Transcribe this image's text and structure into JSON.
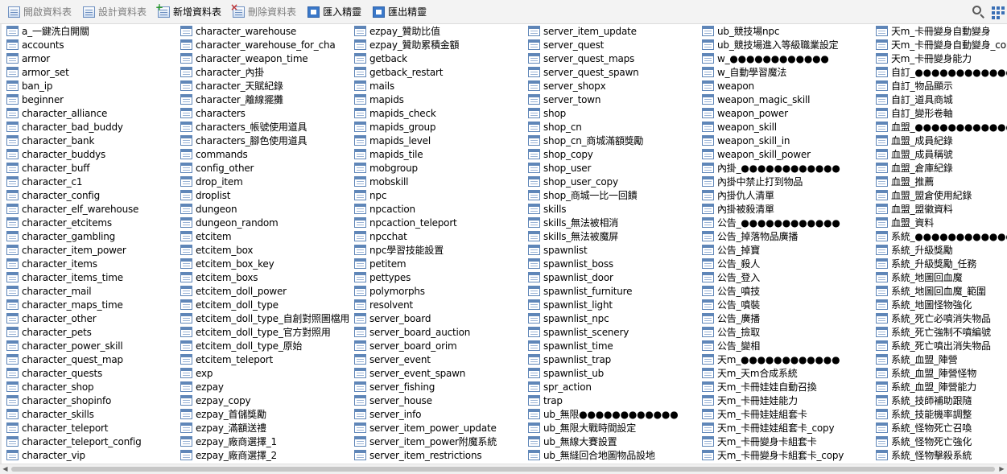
{
  "toolbar": {
    "open_table": "開啟資料表",
    "design_table": "設計資料表",
    "new_table": "新增資料表",
    "delete_table": "刪除資料表",
    "import_wizard": "匯入精靈",
    "export_wizard": "匯出精靈"
  },
  "icons": {
    "search": "search-icon",
    "view_mode": "grid-view-icon",
    "table": "table-icon"
  },
  "colors": {
    "toolbar_bg": "#f3f3f3",
    "table_icon": "#5f86b8",
    "disabled_text": "#7d7d7d"
  },
  "tables": [
    [
      "a_一鍵洗白開關",
      "accounts",
      "armor",
      "armor_set",
      "ban_ip",
      "beginner",
      "character_alliance",
      "character_bad_buddy",
      "character_bank",
      "character_buddys",
      "character_buff",
      "character_c1",
      "character_config",
      "character_elf_warehouse",
      "character_etcitems",
      "character_gambling",
      "character_item_power",
      "character_items",
      "character_items_time",
      "character_mail",
      "character_maps_time",
      "character_other",
      "character_pets",
      "character_power_skill",
      "character_quest_map",
      "character_quests",
      "character_shop",
      "character_shopinfo",
      "character_skills",
      "character_teleport",
      "character_teleport_config",
      "character_vip"
    ],
    [
      "character_warehouse",
      "character_warehouse_for_cha",
      "character_weapon_time",
      "character_內掛",
      "character_天賦紀錄",
      "character_離線擺攤",
      "characters",
      "characters_帳號使用道具",
      "characters_腳色使用道具",
      "commands",
      "config_other",
      "drop_item",
      "droplist",
      "dungeon",
      "dungeon_random",
      "etcitem",
      "etcitem_box",
      "etcitem_box_key",
      "etcitem_boxs",
      "etcitem_doll_power",
      "etcitem_doll_type",
      "etcitem_doll_type_自創對照圖檔用",
      "etcitem_doll_type_官方對照用",
      "etcitem_doll_type_原始",
      "etcitem_teleport",
      "exp",
      "ezpay",
      "ezpay_copy",
      "ezpay_首儲獎勵",
      "ezpay_滿額送禮",
      "ezpay_廠商選擇_1",
      "ezpay_廠商選擇_2"
    ],
    [
      "ezpay_贊助比值",
      "ezpay_贊助累積金額",
      "getback",
      "getback_restart",
      "mails",
      "mapids",
      "mapids_check",
      "mapids_group",
      "mapids_level",
      "mapids_tile",
      "mobgroup",
      "mobskill",
      "npc",
      "npcaction",
      "npcaction_teleport",
      "npcchat",
      "npc學習技能設置",
      "petitem",
      "pettypes",
      "polymorphs",
      "resolvent",
      "server_board",
      "server_board_auction",
      "server_board_orim",
      "server_event",
      "server_event_spawn",
      "server_fishing",
      "server_house",
      "server_info",
      "server_item_power_update",
      "server_item_power附魔系統",
      "server_item_restrictions"
    ],
    [
      "server_item_update",
      "server_quest",
      "server_quest_maps",
      "server_quest_spawn",
      "server_shopx",
      "server_town",
      "shop",
      "shop_cn",
      "shop_cn_商城滿額獎勵",
      "shop_copy",
      "shop_user",
      "shop_user_copy",
      "shop_商城一比一回饋",
      "skills",
      "skills_無法被相消",
      "skills_無法被魔屏",
      "spawnlist",
      "spawnlist_boss",
      "spawnlist_door",
      "spawnlist_furniture",
      "spawnlist_light",
      "spawnlist_npc",
      "spawnlist_scenery",
      "spawnlist_time",
      "spawnlist_trap",
      "spawnlist_ub",
      "spr_action",
      "trap",
      "ub_無限●●●●●●●●●●●●",
      "ub_無限大戰時間設定",
      "ub_無線大賽設置",
      "ub_無縫回合地圖物品設地"
    ],
    [
      "ub_競技場npc",
      "ub_競技場進入等級職業設定",
      "w_●●●●●●●●●●●●",
      "w_自動學習魔法",
      "weapon",
      "weapon_magic_skill",
      "weapon_power",
      "weapon_skill",
      "weapon_skill_in",
      "weapon_skill_power",
      "內掛_●●●●●●●●●●●●",
      "內掛中禁止打到物品",
      "內掛仇人清單",
      "內掛被殺清單",
      "公告_●●●●●●●●●●●●",
      "公告_掉落物品廣播",
      "公告_掉寶",
      "公告_殺人",
      "公告_登入",
      "公告_噴技",
      "公告_噴裝",
      "公告_廣播",
      "公告_撿取",
      "公告_變相",
      "天m_●●●●●●●●●●●●",
      "天m_天m合成系統",
      "天m_卡冊娃娃自動召換",
      "天m_卡冊娃娃能力",
      "天m_卡冊娃娃組套卡",
      "天m_卡冊娃娃組套卡_copy",
      "天m_卡冊變身卡組套卡",
      "天m_卡冊變身卡組套卡_copy"
    ],
    [
      "天m_卡冊變身自動變身",
      "天m_卡冊變身自動變身_copy",
      "天m_卡冊變身能力",
      "自訂_●●●●●●●●●●●●",
      "自訂_物品顯示",
      "自訂_道具商城",
      "自訂_變形卷軸",
      "血盟_●●●●●●●●●●●●",
      "血盟_成員紀錄",
      "血盟_成員稱號",
      "血盟_倉庫紀錄",
      "血盟_推薦",
      "血盟_盟倉使用紀錄",
      "血盟_盟徽資料",
      "血盟_資料",
      "系統_●●●●●●●●●●●●",
      "系統_升級獎勵",
      "系統_升級獎勵_任務",
      "系統_地圖回血魔",
      "系統_地圖回血魔_範圍",
      "系統_地圖怪物強化",
      "系統_死亡必噴消失物品",
      "系統_死亡強制不噴編號",
      "系統_死亡噴出消失物品",
      "系統_血盟_陣營",
      "系統_血盟_陣營怪物",
      "系統_血盟_陣營能力",
      "系統_技師補助跟隨",
      "系統_技能機率調整",
      "系統_怪物死亡召喚",
      "系統_怪物死亡強化",
      "系統_怪物擊殺系統"
    ]
  ]
}
